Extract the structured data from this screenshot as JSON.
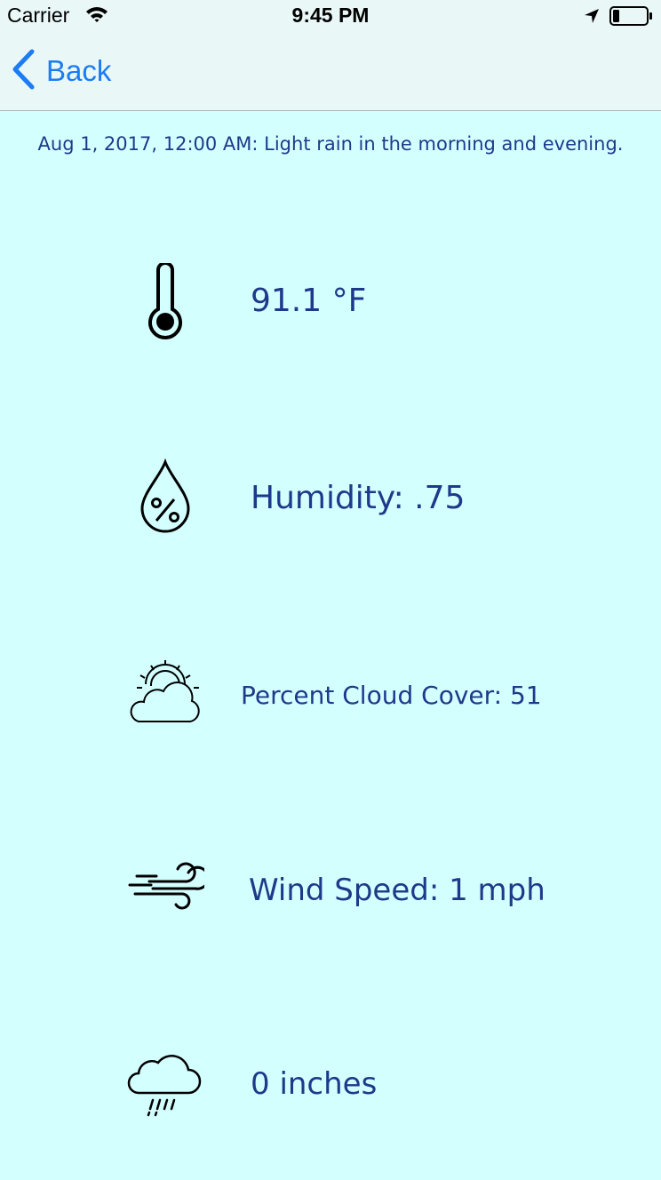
{
  "status_bar": {
    "carrier": "Carrier",
    "time": "9:45 PM"
  },
  "nav": {
    "back_label": "Back"
  },
  "summary": "Aug 1, 2017, 12:00 AM: Light rain in the morning and evening.",
  "rows": [
    {
      "icon": "thermometer-icon",
      "value": "91.1 °F"
    },
    {
      "icon": "humidity-drop-icon",
      "value": "Humidity: .75"
    },
    {
      "icon": "partly-cloudy-icon",
      "value": "Percent Cloud Cover: 51"
    },
    {
      "icon": "wind-icon",
      "value": "Wind Speed: 1 mph"
    },
    {
      "icon": "rain-cloud-icon",
      "value": "0 inches"
    }
  ],
  "colors": {
    "background": "#d4ffff",
    "bar_background": "#eaf7f7",
    "text": "#1d3a8a",
    "accent": "#1b7cf3"
  }
}
